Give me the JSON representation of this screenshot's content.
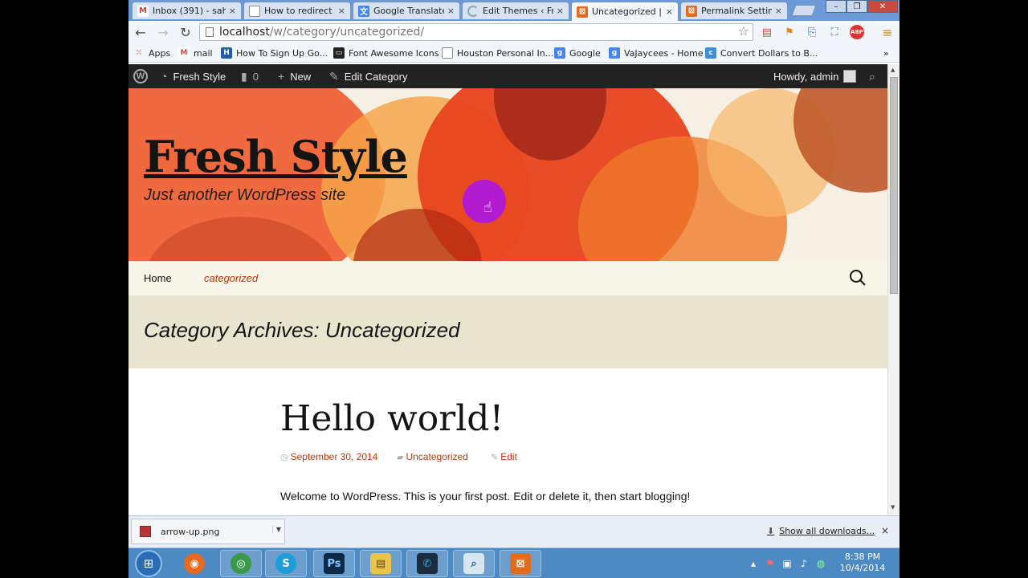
{
  "browser": {
    "tabs": [
      {
        "label": "Inbox (391) - sah",
        "favicon": "gmail-icon",
        "color": "#d14836",
        "glyph": "M"
      },
      {
        "label": "How to redirect a",
        "favicon": "page-icon",
        "color": "#ffffff",
        "glyph": ""
      },
      {
        "label": "Google Translate",
        "favicon": "translate-icon",
        "color": "#4285f4",
        "glyph": "文"
      },
      {
        "label": "Edit Themes ‹ Fre",
        "favicon": "loading-icon",
        "color": "#ffffff",
        "glyph": ""
      },
      {
        "label": "Uncategorized | F",
        "favicon": "xampp-icon",
        "color": "#e06c1f",
        "glyph": "⊠"
      },
      {
        "label": "Permalink Setting",
        "favicon": "xampp-icon",
        "color": "#e06c1f",
        "glyph": "⊠"
      }
    ],
    "tab_close": "×",
    "window_controls": {
      "minimize": "–",
      "maximize": "❐",
      "close": "✕"
    },
    "url_host": "localhost",
    "url_path": "/w/category/uncategorized/",
    "bookmarks": [
      {
        "label": "Apps",
        "color": "#e04a3f",
        "glyph": "⋮⋮"
      },
      {
        "label": "mail",
        "color": "#d14836",
        "glyph": "M"
      },
      {
        "label": "How To Sign Up Go...",
        "color": "#1e5fa6",
        "glyph": "H"
      },
      {
        "label": "Font Awesome Icons",
        "color": "#222222",
        "glyph": "▭"
      },
      {
        "label": "Houston Personal In...",
        "color": "#ffffff",
        "glyph": ""
      },
      {
        "label": "Google",
        "color": "#4285f4",
        "glyph": "g"
      },
      {
        "label": "VaJaycees - Home",
        "color": "#4285f4",
        "glyph": "g"
      },
      {
        "label": "Convert Dollars to B...",
        "color": "#3c8fd8",
        "glyph": "c"
      }
    ],
    "bookmarks_overflow": "»"
  },
  "adminbar": {
    "site_name": "Fresh Style",
    "comments_count": "0",
    "new_label": "New",
    "edit_label": "Edit Category",
    "greeting": "Howdy, admin"
  },
  "site": {
    "title": "Fresh Style",
    "description": "Just another WordPress site",
    "nav": [
      "Home",
      "categorized"
    ]
  },
  "archive": {
    "title": "Category Archives: Uncategorized"
  },
  "post": {
    "title": "Hello world!",
    "date": "September 30, 2014",
    "category": "Uncategorized",
    "edit": "Edit",
    "content": "Welcome to WordPress. This is your first post. Edit or delete it, then start blogging!"
  },
  "downloads": {
    "file": "arrow-up.png",
    "show_all": "Show all downloads...",
    "close": "×"
  },
  "taskbar": {
    "time": "8:38 PM",
    "date": "10/4/2014",
    "apps": [
      {
        "name": "firefox",
        "color": "#e66a1f",
        "glyph": "◉"
      },
      {
        "name": "chrome",
        "color": "#3b9a4a",
        "glyph": "◎"
      },
      {
        "name": "skype",
        "color": "#1d9ed9",
        "glyph": "S"
      },
      {
        "name": "photoshop",
        "color": "#0b2a4a",
        "glyph": "Ps"
      },
      {
        "name": "explorer",
        "color": "#e9c34a",
        "glyph": "▤"
      },
      {
        "name": "dialer",
        "color": "#1a2c3d",
        "glyph": "✆"
      },
      {
        "name": "search",
        "color": "#d8e6f2",
        "glyph": "⌕"
      },
      {
        "name": "xampp",
        "color": "#e06c1f",
        "glyph": "⊠"
      }
    ]
  },
  "colors": {
    "accent": "#bc360a",
    "header_bg": "#f6efe3",
    "nav_bg": "#f7f5e7",
    "archive_bg": "#e8e5ce",
    "adminbar_bg": "#222222"
  }
}
